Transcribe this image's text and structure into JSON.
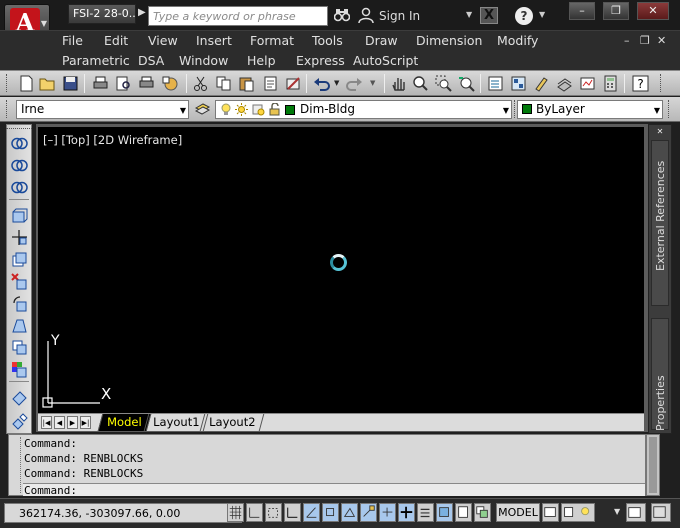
{
  "window": {
    "doc_title": "FSI-2 28-0...",
    "search_placeholder": "Type a keyword or phrase",
    "sign_in_label": "Sign In",
    "help_label": "?",
    "win_minimize": "–",
    "win_restore": "❐",
    "win_close": "✕"
  },
  "menu": {
    "row1": [
      "File",
      "Edit",
      "View",
      "Insert",
      "Format",
      "Tools",
      "Draw",
      "Dimension",
      "Modify"
    ],
    "row2": [
      "Parametric",
      "DSA",
      "Window",
      "Help",
      "Express",
      "AutoScript"
    ],
    "doc_controls": [
      "–",
      "❐",
      "✕"
    ]
  },
  "layerbar": {
    "workspace_value": "Irne",
    "layer_value": "Dim-Bldg",
    "color_value": "ByLayer"
  },
  "viewport": {
    "label": "[–] [Top] [2D Wireframe]",
    "ucs_y": "Y",
    "ucs_x": "X"
  },
  "layout_tabs": [
    "Model",
    "Layout1",
    "Layout2"
  ],
  "palettes": {
    "external_references": "External References",
    "properties": "Properties"
  },
  "command_window": {
    "lines": [
      "Command:",
      "Command: RENBLOCKS",
      "Command: RENBLOCKS"
    ],
    "prompt": "Command:"
  },
  "status": {
    "coordinates": "362174.36, -303097.66, 0.00",
    "space": "MODEL"
  },
  "colors": {
    "layer_swatch": "#007a0a",
    "active_tab_text": "#ffff00",
    "app_logo": "#c3141b"
  }
}
